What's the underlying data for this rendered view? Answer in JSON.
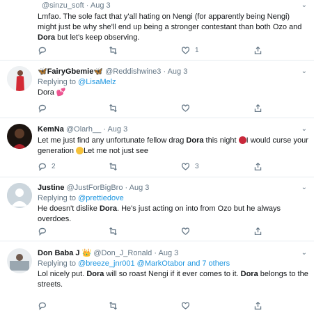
{
  "tweets": [
    {
      "handle": "@sinzu_soft",
      "time": "Aug 3",
      "body_parts": [
        "Lmfao. The sole fact that y'all hating on Nengi (for apparently being Nengi) might just be why she'll end up being a stronger contestant than both Ozo and ",
        "Dora",
        " but let's keep observing."
      ],
      "replies": "",
      "retweets": "",
      "likes": "1"
    },
    {
      "name": "FairyGbemie",
      "handle": "@Reddishwine3",
      "time": "Aug 3",
      "replying_label": "Replying to",
      "replying_to": "@LisaMelz",
      "body": "Dora",
      "replies": "",
      "retweets": "",
      "likes": ""
    },
    {
      "name": "KemNa",
      "handle": "@Olarh__",
      "time": "Aug 3",
      "body_parts": [
        "Let me just find any unfortunate fellow drag ",
        "Dora",
        " this night ",
        "I would curse your generation ",
        "Let me not just see"
      ],
      "replies": "2",
      "retweets": "",
      "likes": "3"
    },
    {
      "name": "Justine",
      "handle": "@JustForBigBro",
      "time": "Aug 3",
      "replying_label": "Replying to",
      "replying_to": "@prettiedove",
      "body_parts": [
        "He doesn't dislike ",
        "Dora",
        ". He's just acting on into from Ozo but he always overdoes."
      ],
      "replies": "",
      "retweets": "",
      "likes": ""
    },
    {
      "name": "Don Baba J",
      "handle": "@Don_J_Ronald",
      "time": "Aug 3",
      "replying_label": "Replying to",
      "replying_to": "@breeze_jnr001 @MarkOtabor and 7 others",
      "body_parts": [
        "Lol nicely put. ",
        "Dora",
        " will so roast Nengi if it ever comes to it. ",
        "Dora",
        " belongs to the streets."
      ],
      "replies": "",
      "retweets": "",
      "likes": ""
    }
  ],
  "separator": "·",
  "colors": {
    "link": "#1b95e0",
    "muted": "#657786",
    "divider": "#e6ecf0"
  },
  "icons": [
    "chevron-down-icon",
    "reply-icon",
    "retweet-icon",
    "like-icon",
    "share-icon",
    "butterfly-emoji",
    "hearts-emoji",
    "angry-emoji",
    "crying-laughing-emoji",
    "crown-emoji"
  ]
}
